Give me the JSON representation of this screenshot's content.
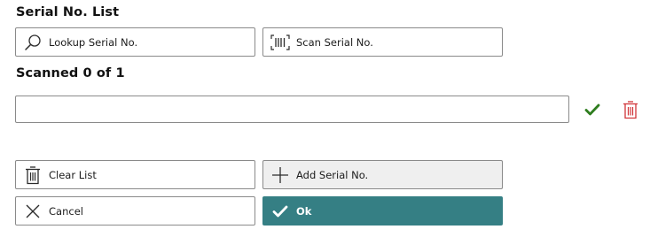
{
  "header": {
    "title": "Serial No. List",
    "scanned_status": "Scanned 0 of 1"
  },
  "actions": {
    "lookup_label": "Lookup Serial No.",
    "scan_label": "Scan Serial No."
  },
  "entry": {
    "value": "",
    "placeholder": ""
  },
  "footer": {
    "clear_label": "Clear List",
    "add_label": "Add Serial No.",
    "cancel_label": "Cancel",
    "ok_label": "Ok"
  },
  "icons": {
    "lookup": "search-icon",
    "scan": "barcode-scan-icon",
    "confirm": "checkmark-icon",
    "delete": "trash-icon",
    "clear": "trash-icon",
    "add": "plus-icon",
    "cancel": "close-icon",
    "ok": "checkmark-icon"
  },
  "colors": {
    "primary": "#357f84",
    "confirm_green": "#2e7d1e",
    "delete_red": "#d13438"
  }
}
